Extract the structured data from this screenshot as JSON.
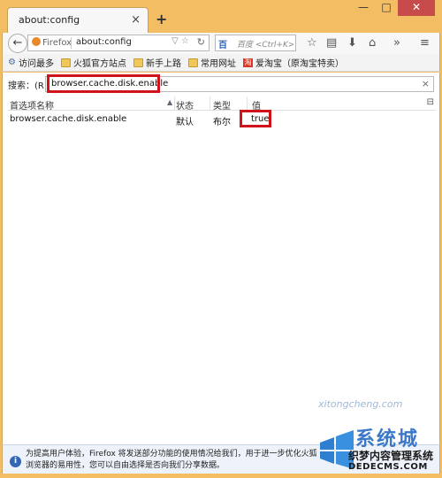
{
  "tab": {
    "title": "about:config",
    "close_glyph": "×",
    "new_tab_glyph": "+"
  },
  "window_controls": {
    "minimize": "—",
    "maximize": "□",
    "close": "✕"
  },
  "nav": {
    "back_glyph": "←",
    "identity_label": "Firefox",
    "url": "about:config",
    "url_arrows": "▽ ☆",
    "reload_glyph": "↻",
    "search_engine": "百",
    "search_placeholder": "百度 <Ctrl+K>",
    "toolbar_icons": [
      "star-icon",
      "bookmarks-list-icon",
      "download-icon",
      "home-icon",
      "overflow-icon",
      "menu-icon"
    ]
  },
  "bookmarks": [
    {
      "label": "访问最多",
      "icon": "gear-icon"
    },
    {
      "label": "火狐官方站点",
      "icon": "folder-icon"
    },
    {
      "label": "新手上路",
      "icon": "folder-icon"
    },
    {
      "label": "常用网址",
      "icon": "folder-icon"
    },
    {
      "label": "爱淘宝（原淘宝特卖）",
      "icon": "taobao-icon"
    }
  ],
  "filter": {
    "label": "搜索：(R)",
    "value": "browser.cache.disk.enable",
    "clear_glyph": "×"
  },
  "columns": {
    "name": "首选项名称",
    "status": "状态",
    "type": "类型",
    "value": "值"
  },
  "prefs": [
    {
      "name": "browser.cache.disk.enable",
      "status": "默认",
      "type": "布尔",
      "value": "true"
    }
  ],
  "notification": {
    "text": "为提高用户体验，Firefox 将发送部分功能的使用情况给我们，用于进一步优化火狐浏览器的易用性，您可以自由选择是否向我们分享数据。"
  },
  "watermark": {
    "brand_cn": "系统城",
    "brand_en": "xitongcheng.com",
    "site_cn": "织梦内容管理系统",
    "site_url": "DEDECMS.COM"
  },
  "colors": {
    "frame": "#f3be63",
    "highlight": "#d0121b",
    "info": "#3266b5"
  }
}
